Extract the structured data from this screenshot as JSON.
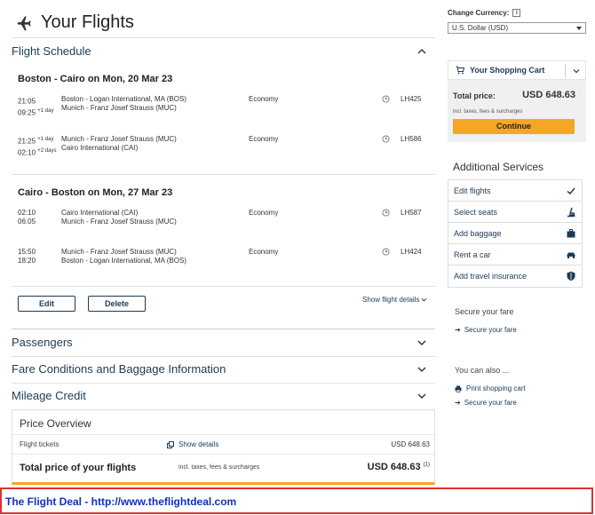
{
  "page": {
    "title": "Your Flights"
  },
  "schedule": {
    "title": "Flight Schedule",
    "journeys": [
      {
        "route": "Boston - Cairo on Mon, 20 Mar 23",
        "segments": [
          {
            "dep_time": "21:05",
            "dep_offset": "",
            "arr_time": "09:25",
            "arr_offset": "+1 day",
            "from": "Boston - Logan International, MA (BOS)",
            "to": "Munich - Franz Josef Strauss (MUC)",
            "cabin": "Economy",
            "flight": "LH425"
          },
          {
            "dep_time": "21:25",
            "dep_offset": "+1 day",
            "arr_time": "02:10",
            "arr_offset": "+2 days",
            "from": "Munich - Franz Josef Strauss (MUC)",
            "to": "Cairo International (CAI)",
            "cabin": "Economy",
            "flight": "LH586"
          }
        ]
      },
      {
        "route": "Cairo - Boston on Mon, 27 Mar 23",
        "segments": [
          {
            "dep_time": "02:10",
            "dep_offset": "",
            "arr_time": "06:05",
            "arr_offset": "",
            "from": "Cairo International (CAI)",
            "to": "Munich - Franz Josef Strauss (MUC)",
            "cabin": "Economy",
            "flight": "LH587"
          },
          {
            "dep_time": "15:50",
            "dep_offset": "",
            "arr_time": "18:20",
            "arr_offset": "",
            "from": "Munich - Franz Josef Strauss (MUC)",
            "to": "Boston - Logan International, MA (BOS)",
            "cabin": "Economy",
            "flight": "LH424"
          }
        ]
      }
    ],
    "edit_label": "Edit",
    "delete_label": "Delete",
    "show_details_label": "Show flight details"
  },
  "sections": {
    "passengers": "Passengers",
    "fare_conditions": "Fare Conditions and Baggage Information",
    "mileage": "Mileage Credit"
  },
  "price_overview": {
    "title": "Price Overview",
    "tickets_label": "Flight tickets",
    "show_details": "Show details",
    "tickets_value": "USD 648.63",
    "total_label": "Total price of your flights",
    "total_incl": "incl. taxes, fees & surcharges",
    "total_value": "USD 648.63",
    "footnote": "(1)"
  },
  "sidebar": {
    "currency_label": "Change Currency:",
    "info_glyph": "i",
    "currency_value": "U.S. Dollar (USD)",
    "cart_title": "Your Shopping Cart",
    "total_label": "Total price:",
    "total_value": "USD 648.63",
    "total_incl": "incl. taxes, fees & surcharges",
    "continue_label": "Continue",
    "additional_title": "Additional Services",
    "services": [
      {
        "label": "Edit flights",
        "icon": "check-icon"
      },
      {
        "label": "Select seats",
        "icon": "seat-icon"
      },
      {
        "label": "Add baggage",
        "icon": "baggage-icon"
      },
      {
        "label": "Rent a car",
        "icon": "car-icon"
      },
      {
        "label": "Add travel insurance",
        "icon": "shield-icon"
      }
    ],
    "secure_title": "Secure your fare",
    "secure_link": "Secure your fare",
    "also_title": "You can also ...",
    "print_link": "Print shopping cart",
    "secure_link_2": "Secure your fare"
  },
  "banner": {
    "text": "The Flight Deal - http://www.theflightdeal.com"
  },
  "colors": {
    "accent": "#f5a623",
    "link": "#1c3a57",
    "banner_border": "#e03030",
    "banner_text": "#1030c0"
  }
}
